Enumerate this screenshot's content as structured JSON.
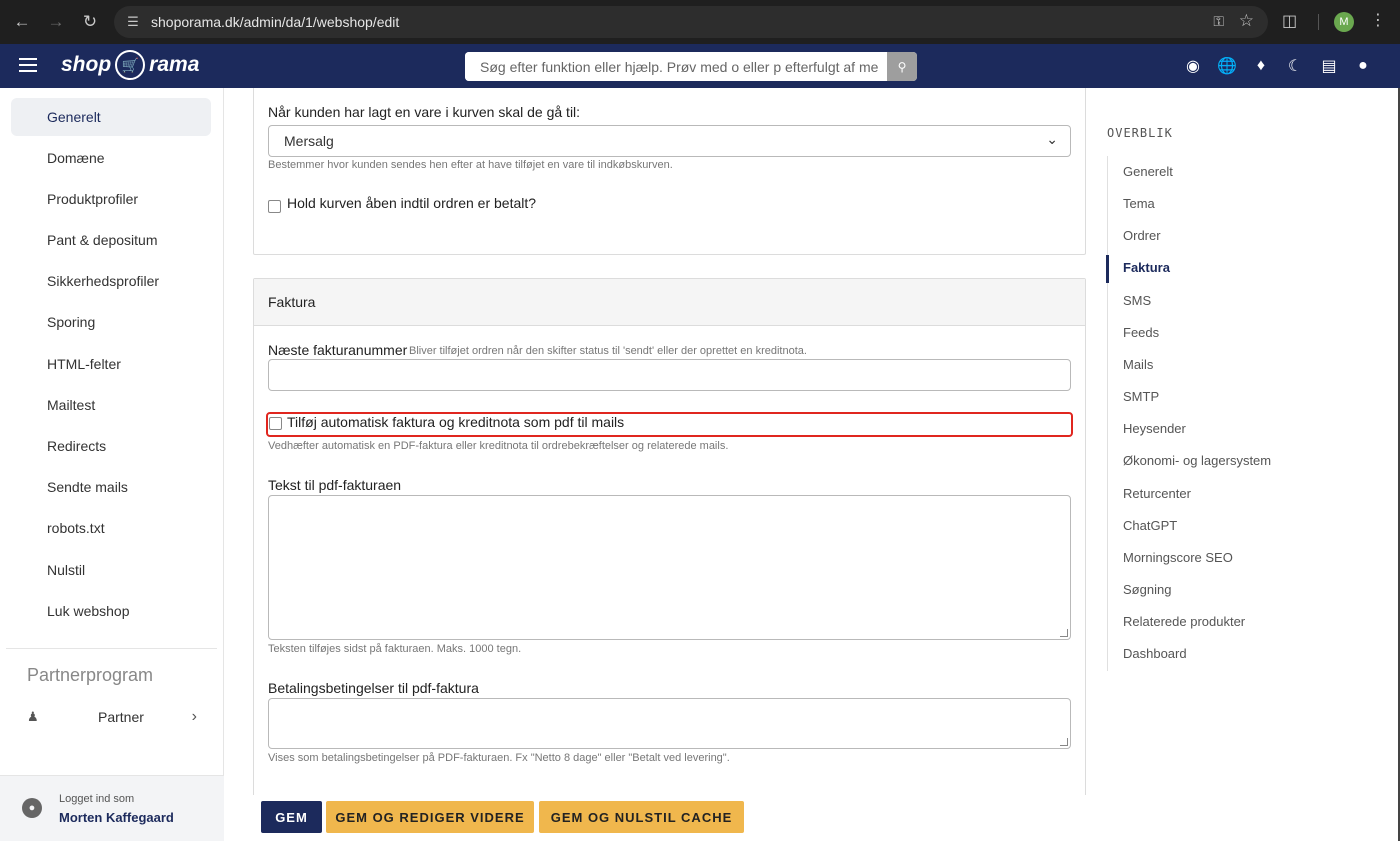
{
  "browser": {
    "url": "shoporama.dk/admin/da/1/webshop/edit",
    "profile_initial": "M"
  },
  "app": {
    "logo_left": "shop",
    "logo_right": "rama",
    "search_placeholder": "Søg efter funktion eller hjælp. Prøv med o eller p efterfulgt af me"
  },
  "sidebar": {
    "items": [
      {
        "label": "Generelt",
        "active": true
      },
      {
        "label": "Domæne"
      },
      {
        "label": "Produktprofiler"
      },
      {
        "label": "Pant & depositum"
      },
      {
        "label": "Sikkerhedsprofiler"
      },
      {
        "label": "Sporing"
      },
      {
        "label": "HTML-felter"
      },
      {
        "label": "Mailtest"
      },
      {
        "label": "Redirects"
      },
      {
        "label": "Sendte mails"
      },
      {
        "label": "robots.txt"
      },
      {
        "label": "Nulstil"
      },
      {
        "label": "Luk webshop"
      }
    ],
    "partner_title": "Partnerprogram",
    "partner_label": "Partner",
    "footer_logged_in": "Logget ind som",
    "footer_user": "Morten Kaffegaard"
  },
  "cart_section": {
    "redirect_label": "Når kunden har lagt en vare i kurven skal de gå til:",
    "redirect_value": "Mersalg",
    "redirect_hint": "Bestemmer hvor kunden sendes hen efter at have tilføjet en vare til indkøbskurven.",
    "hold_cart_label": "Hold kurven åben indtil ordren er betalt?"
  },
  "invoice_section": {
    "title": "Faktura",
    "next_number_label": "Næste fakturanummer",
    "next_number_hint": "Bliver tilføjet ordren når den skifter status til 'sendt' eller der oprettet en kreditnota.",
    "next_number_value": "",
    "auto_pdf_label": "Tilføj automatisk faktura og kreditnota som pdf til mails",
    "auto_pdf_hint": "Vedhæfter automatisk en PDF-faktura eller kreditnota til ordrebekræftelser og relaterede mails.",
    "pdf_text_label": "Tekst til pdf-fakturaen",
    "pdf_text_value": "",
    "pdf_text_hint": "Teksten tilføjes sidst på fakturaen. Maks. 1000 tegn.",
    "payment_terms_label": "Betalingsbetingelser til pdf-faktura",
    "payment_terms_value": "",
    "payment_terms_hint": "Vises som betalingsbetingelser på PDF-fakturaen. Fx \"Netto 8 dage\" eller \"Betalt ved levering\"."
  },
  "actions": {
    "save": "GEM",
    "save_continue": "GEM OG REDIGER VIDERE",
    "save_reset_cache": "GEM OG NULSTIL CACHE"
  },
  "outline": {
    "title": "OVERBLIK",
    "active": "Faktura",
    "links": [
      "Generelt",
      "Tema",
      "Ordrer",
      "Faktura",
      "SMS",
      "Feeds",
      "Mails",
      "SMTP",
      "Heysender",
      "Økonomi- og lagersystem",
      "Returcenter",
      "ChatGPT",
      "Morningscore SEO",
      "Søgning",
      "Relaterede produkter",
      "Dashboard"
    ]
  },
  "colors": {
    "brand_navy": "#1c2a5c",
    "accent_yellow": "#f0b74d",
    "highlight_red": "#e0261f"
  }
}
